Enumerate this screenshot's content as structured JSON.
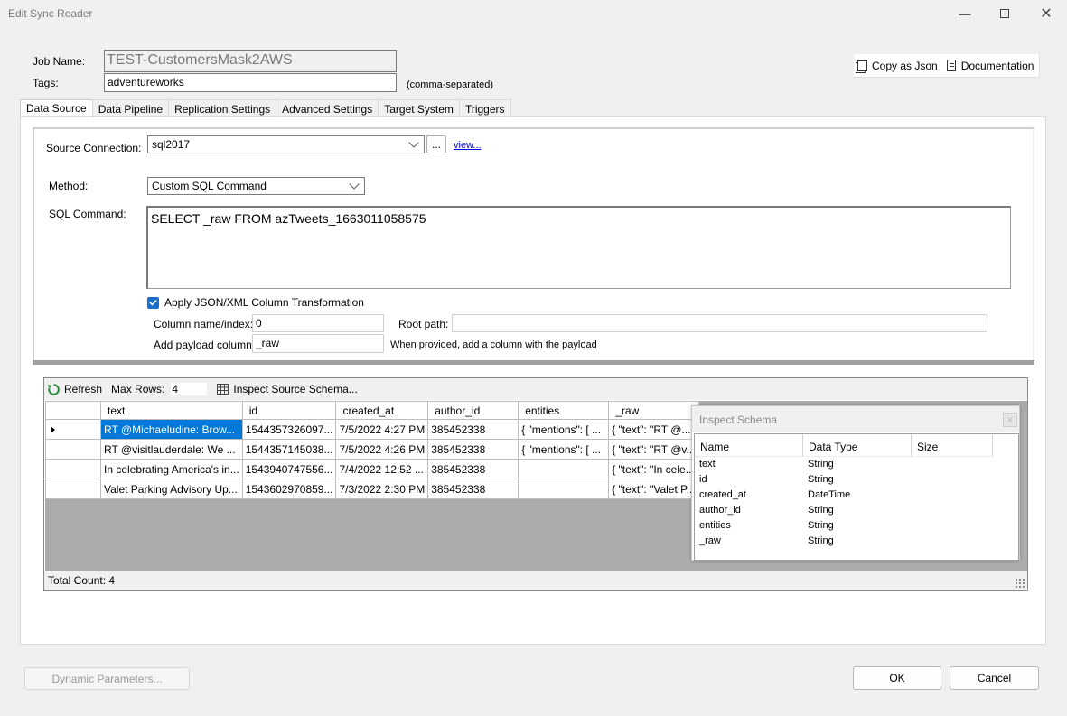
{
  "window": {
    "title": "Edit Sync Reader"
  },
  "header": {
    "job_name_label": "Job Name:",
    "job_name_value": "TEST-CustomersMask2AWS",
    "tags_label": "Tags:",
    "tags_value": "adventureworks",
    "tags_hint": "(comma-separated)",
    "copy_json_label": "Copy as Json",
    "documentation_label": "Documentation"
  },
  "tabs": [
    "Data Source",
    "Data Pipeline",
    "Replication Settings",
    "Advanced Settings",
    "Target System",
    "Triggers"
  ],
  "source": {
    "connection_label": "Source Connection:",
    "connection_value": "sql2017",
    "browse_label": "...",
    "view_link": "view...",
    "method_label": "Method:",
    "method_value": "Custom SQL Command",
    "sql_label": "SQL Command:",
    "sql_value": "SELECT _raw FROM azTweets_1663011058575",
    "apply_label": "Apply JSON/XML Column Transformation",
    "apply_checked": true,
    "column_label": "Column name/index:",
    "column_value": "0",
    "root_label": "Root path:",
    "root_value": "",
    "payload_label": "Add payload column:",
    "payload_value": "_raw",
    "payload_hint": "When provided, add a column with the payload"
  },
  "grid": {
    "refresh_label": "Refresh",
    "maxrows_label": "Max Rows:",
    "maxrows_value": "4",
    "inspect_label": "Inspect Source Schema...",
    "columns": [
      "text",
      "id",
      "created_at",
      "author_id",
      "entities",
      "_raw"
    ],
    "rows": [
      [
        "RT @Michaeludine: Brow...",
        "1544357326097...",
        "7/5/2022 4:27 PM",
        "385452338",
        "{  \"mentions\": [   ...",
        "{  \"text\": \"RT @..."
      ],
      [
        "RT @visitlauderdale: We ...",
        "1544357145038...",
        "7/5/2022 4:26 PM",
        "385452338",
        "{  \"mentions\": [   ...",
        "{  \"text\": \"RT @v..."
      ],
      [
        "In celebrating America's in...",
        "1543940747556...",
        "7/4/2022 12:52 ...",
        "385452338",
        "",
        "{  \"text\": \"In cele..."
      ],
      [
        "Valet Parking Advisory Up...",
        "1543602970859...",
        "7/3/2022 2:30 PM",
        "385452338",
        "",
        "{  \"text\": \"Valet P..."
      ]
    ],
    "total_label": "Total Count: 4"
  },
  "schema": {
    "title": "Inspect Schema",
    "headers": [
      "Name",
      "Data Type",
      "Size"
    ],
    "rows": [
      [
        "text",
        "String"
      ],
      [
        "id",
        "String"
      ],
      [
        "created_at",
        "DateTime"
      ],
      [
        "author_id",
        "String"
      ],
      [
        "entities",
        "String"
      ],
      [
        "_raw",
        "String"
      ]
    ]
  },
  "footer": {
    "dynamic_label": "Dynamic Parameters...",
    "ok_label": "OK",
    "cancel_label": "Cancel"
  },
  "colors": {
    "accent": "#0078d7",
    "link": "#0000ee",
    "grid_bg": "#ababab"
  }
}
